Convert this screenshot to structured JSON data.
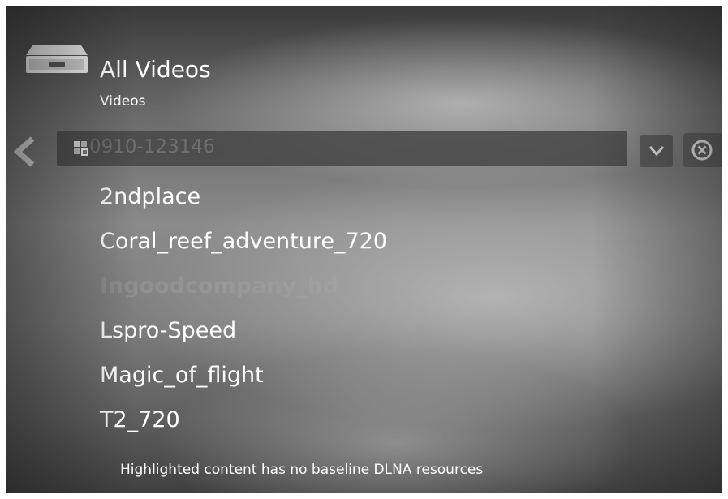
{
  "header": {
    "title": "All Videos",
    "subtitle": "Videos",
    "device_icon": "media-server-icon"
  },
  "filter": {
    "value": "0910-123146",
    "icon": "thumbnail-grid-icon",
    "back_icon": "back-arrow-icon",
    "dropdown_icon": "chevron-down-icon",
    "clear_icon": "clear-circle-icon"
  },
  "items": [
    {
      "label": "2ndplace",
      "state": "normal"
    },
    {
      "label": "Coral_reef_adventure_720",
      "state": "normal"
    },
    {
      "label": "Ingoodcompany_hd",
      "state": "dimmed"
    },
    {
      "label": "Lspro-Speed",
      "state": "normal"
    },
    {
      "label": "Magic_of_flight",
      "state": "normal"
    },
    {
      "label": "T2_720",
      "state": "normal"
    }
  ],
  "status": {
    "message": "Highlighted content has no baseline DLNA resources"
  },
  "colors": {
    "text": "#ffffff",
    "filter_bar": "#464646",
    "dimmed_text": "#aaaaaa"
  }
}
